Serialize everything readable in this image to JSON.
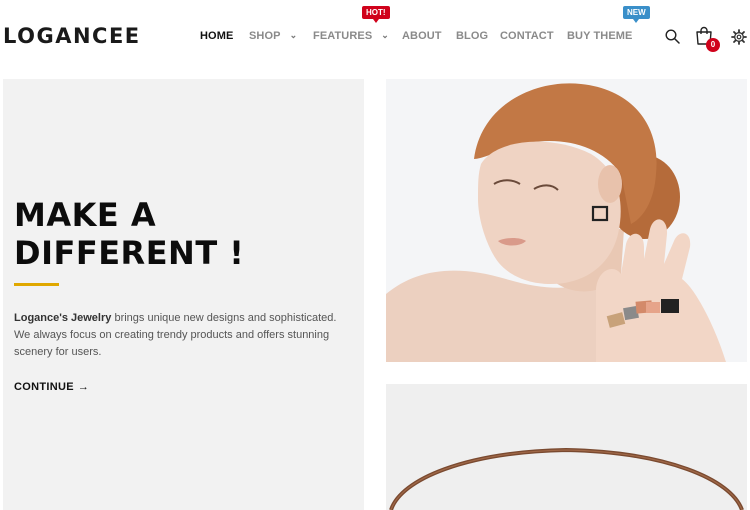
{
  "header": {
    "logo": "LOGANCEE",
    "nav": [
      {
        "label": "HOME",
        "active": true
      },
      {
        "label": "SHOP",
        "has_dropdown": true
      },
      {
        "label": "FEATURES",
        "has_dropdown": true,
        "badge": "HOT!"
      },
      {
        "label": "ABOUT"
      },
      {
        "label": "BLOG"
      },
      {
        "label": "CONTACT"
      },
      {
        "label": "BUY THEME",
        "badge": "NEW"
      }
    ],
    "cart_count": "0",
    "icons": [
      "search-icon",
      "cart-icon",
      "gear-icon"
    ]
  },
  "colors": {
    "hot_badge": "#d0021b",
    "new_badge": "#3a8fc9",
    "accent_rule": "#e0a800",
    "cart_badge": "#d0021b",
    "hero_bg": "#f2f2f2"
  },
  "hero": {
    "title_line1": "MAKE A",
    "title_line2": "DIFFERENT !",
    "brand": "Logance's Jewelry",
    "text_line1_rest": " brings unique new designs and sophisticated.",
    "text_line2": "We always focus on creating trendy products and offers stunning scenery for users.",
    "cta": "CONTINUE"
  }
}
